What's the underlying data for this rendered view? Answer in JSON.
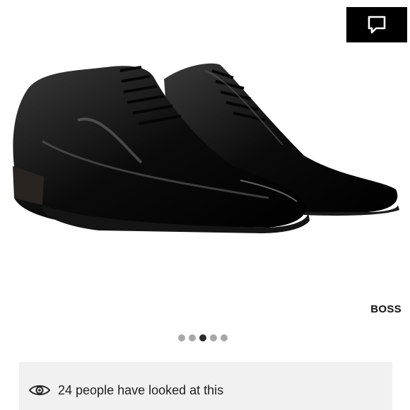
{
  "product": {
    "brand": "BOSS",
    "image_icon": "patent-leather-oxford-shoes"
  },
  "actions": {
    "chat_icon": "chat-bubble-icon"
  },
  "carousel": {
    "total": 5,
    "active_index": 2
  },
  "views": {
    "icon": "eye-icon",
    "text": "24 people have looked at this"
  },
  "colors": {
    "accent": "#000000",
    "dot_inactive": "#a8a8a8",
    "dot_active": "#2a2a2a",
    "banner_bg": "#f1f1f1"
  }
}
